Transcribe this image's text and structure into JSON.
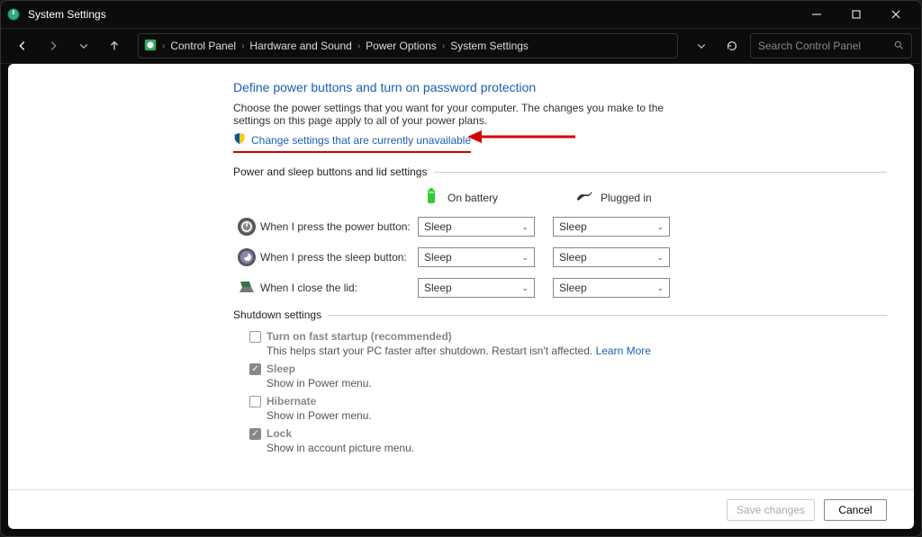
{
  "window": {
    "title": "System Settings"
  },
  "breadcrumb": {
    "items": [
      "Control Panel",
      "Hardware and Sound",
      "Power Options",
      "System Settings"
    ]
  },
  "search": {
    "placeholder": "Search Control Panel"
  },
  "page": {
    "heading": "Define power buttons and turn on password protection",
    "intro": "Choose the power settings that you want for your computer. The changes you make to the settings on this page apply to all of your power plans.",
    "changeLink": "Change settings that are currently unavailable"
  },
  "buttonsSection": {
    "legend": "Power and sleep buttons and lid settings",
    "cols": {
      "battery": "On battery",
      "plugged": "Plugged in"
    },
    "rows": [
      {
        "label": "When I press the power button:",
        "battery": "Sleep",
        "plugged": "Sleep"
      },
      {
        "label": "When I press the sleep button:",
        "battery": "Sleep",
        "plugged": "Sleep"
      },
      {
        "label": "When I close the lid:",
        "battery": "Sleep",
        "plugged": "Sleep"
      }
    ]
  },
  "shutdownSection": {
    "legend": "Shutdown settings",
    "items": [
      {
        "label": "Turn on fast startup (recommended)",
        "sub": "This helps start your PC faster after shutdown. Restart isn't affected.",
        "learn": "Learn More",
        "checked": false
      },
      {
        "label": "Sleep",
        "sub": "Show in Power menu.",
        "checked": true
      },
      {
        "label": "Hibernate",
        "sub": "Show in Power menu.",
        "checked": false
      },
      {
        "label": "Lock",
        "sub": "Show in account picture menu.",
        "checked": true
      }
    ]
  },
  "footer": {
    "save": "Save changes",
    "cancel": "Cancel"
  }
}
